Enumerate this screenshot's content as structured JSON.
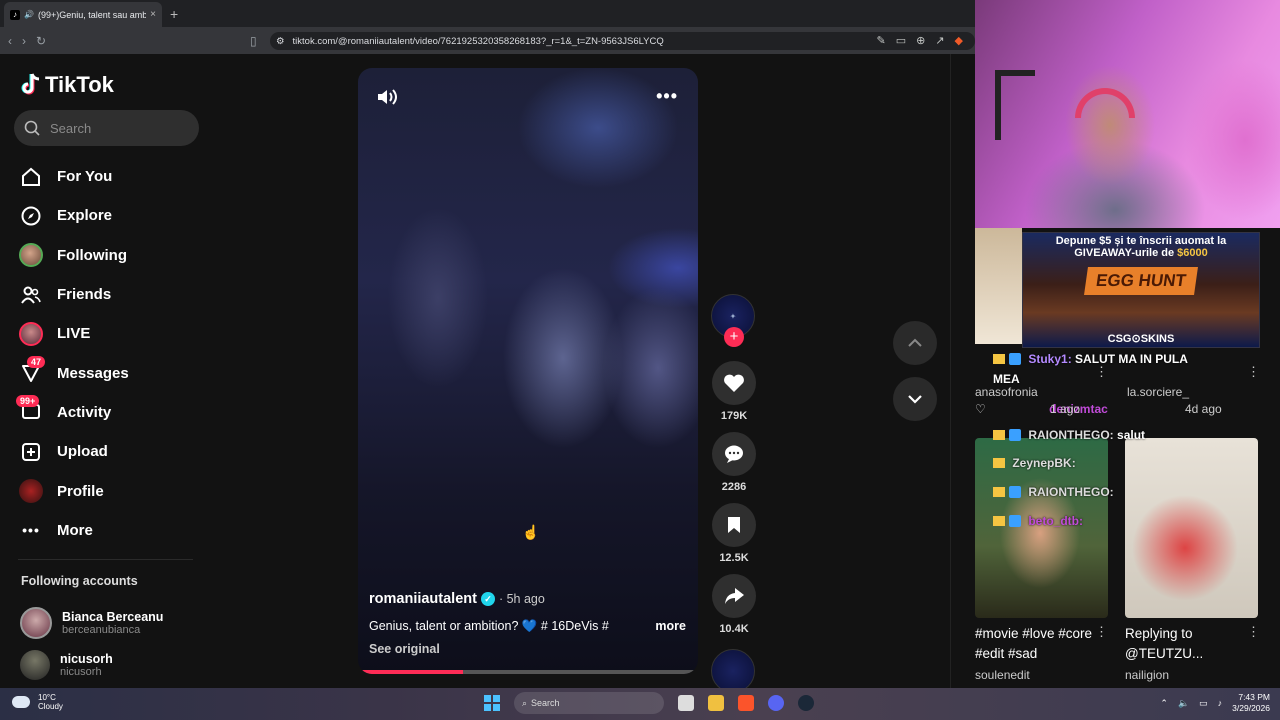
{
  "browser": {
    "tab_title": "(99+)Geniu, talent sau ambiț",
    "tab_close": "×",
    "new_tab": "+",
    "url": "tiktok.com/@romaniiautalent/video/7621925320358268183?_r=1&_t=ZN-9563JS6LYCQ"
  },
  "sidebar": {
    "logo_text": "TikTok",
    "search_placeholder": "Search",
    "nav": [
      {
        "label": "For You",
        "icon": "home-icon"
      },
      {
        "label": "Explore",
        "icon": "compass-icon"
      },
      {
        "label": "Following",
        "icon": "avatar"
      },
      {
        "label": "Friends",
        "icon": "friends-icon"
      },
      {
        "label": "LIVE",
        "icon": "live-avatar"
      },
      {
        "label": "Messages",
        "icon": "messages-icon",
        "badge": "47"
      },
      {
        "label": "Activity",
        "icon": "activity-icon",
        "badge": "99+"
      },
      {
        "label": "Upload",
        "icon": "upload-icon"
      },
      {
        "label": "Profile",
        "icon": "profile-avatar"
      },
      {
        "label": "More",
        "icon": "more-icon"
      }
    ],
    "following_title": "Following accounts",
    "following": [
      {
        "name": "Bianca Berceanu",
        "handle": "berceanubianca"
      },
      {
        "name": "nicusorh",
        "handle": "nicusorh"
      }
    ]
  },
  "video": {
    "username": "romaniiautalent",
    "verified_mark": "✓",
    "time": "· 5h ago",
    "caption": "Genius, talent or ambition? 💙 # 16DeVis #",
    "more_label": "more",
    "see_original": "See original",
    "progress_fraction": 0.31
  },
  "actions": {
    "likes": "179K",
    "comments": "2286",
    "saves": "12.5K",
    "shares": "10.4K"
  },
  "stream": {
    "ad_line1": "Depune $5 și te înscrii auomat la",
    "ad_line2_pre": "GIVEAWAY-urile de ",
    "ad_line2_amount": "$6000",
    "ad_event": "EGG HUNT",
    "ad_brand": "CSG⊙SKINS",
    "chat": [
      {
        "user": "Stuky1:",
        "msg": "SALUT MA IN PULA"
      },
      {
        "user": "",
        "msg": "MEA"
      },
      {
        "user": "RAIONTHEGO:",
        "msg": "salut"
      },
      {
        "user": "ZeynepBK:",
        "msg": ""
      },
      {
        "user": "RAIONTHEGO:",
        "msg": ""
      },
      {
        "user": "beto_dtb:",
        "msg": ""
      }
    ],
    "row1_left_user": "anasofronia",
    "row1_right_user": "la.sorciere_",
    "row1_right_time": "4d ago",
    "row1_left_time": "1 ago",
    "row1_overlay_user": "denizmtac",
    "card1_caption": "#movie #love #core #edit #sad",
    "card1_user": "soulenedit",
    "card2_caption": "Replying to @TEUTZU...",
    "card2_user": "nailigion"
  },
  "taskbar": {
    "temp": "10°C",
    "weather": "Cloudy",
    "search": "Search",
    "time": "7:43 PM",
    "date": "3/29/2026"
  },
  "colors": {
    "accent": "#fe2c55",
    "verified": "#20d5ec",
    "bg": "#121212"
  }
}
